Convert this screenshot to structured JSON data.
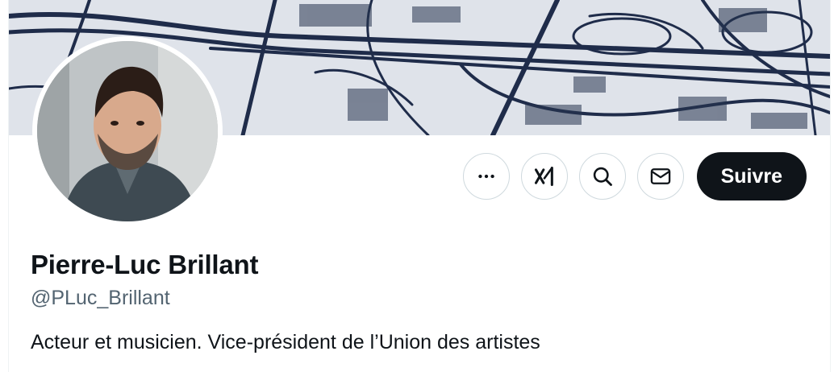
{
  "profile": {
    "name": "Pierre-Luc Brillant",
    "handle": "@PLuc_Brillant",
    "bio": "Acteur et musicien. Vice-président de l’Union des artistes"
  },
  "actions": {
    "more_icon": "more-horizontal-icon",
    "grok_icon": "grok-icon",
    "search_icon": "search-icon",
    "message_icon": "envelope-icon",
    "follow_label": "Suivre"
  },
  "colors": {
    "primary_text": "#0f1419",
    "secondary_text": "#536471",
    "button_border": "#cfd9de",
    "follow_bg": "#0f1419",
    "follow_text": "#ffffff"
  }
}
